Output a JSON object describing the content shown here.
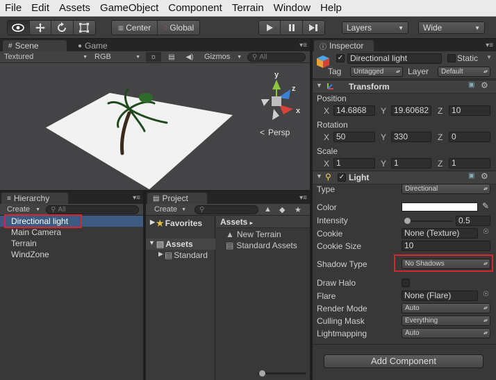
{
  "menubar": [
    "File",
    "Edit",
    "Assets",
    "GameObject",
    "Component",
    "Terrain",
    "Window",
    "Help"
  ],
  "toolbar": {
    "pivot_label": "Center",
    "space_label": "Global",
    "layers_label": "Layers",
    "layout_label": "Wide"
  },
  "scene": {
    "tab_label": "Scene",
    "game_tab_label": "Game",
    "draw_mode": "Textured",
    "render_mode": "RGB",
    "gizmos_label": "Gizmos",
    "search_placeholder": "All",
    "persp_label": "Persp",
    "gizmo_x": "x",
    "gizmo_y": "y",
    "gizmo_z": "z"
  },
  "hierarchy": {
    "tab_label": "Hierarchy",
    "create_label": "Create",
    "search_placeholder": "All",
    "items": [
      "Directional light",
      "Main Camera",
      "Terrain",
      "WindZone"
    ]
  },
  "project": {
    "tab_label": "Project",
    "create_label": "Create",
    "favorites_label": "Favorites",
    "assets_label": "Assets",
    "standard_label": "Standard",
    "assets_header": "Assets",
    "asset_items": [
      "New Terrain",
      "Standard Assets"
    ]
  },
  "inspector": {
    "tab_label": "Inspector",
    "object_name": "Directional light",
    "static_label": "Static",
    "tag_label": "Tag",
    "tag_value": "Untagged",
    "layer_label": "Layer",
    "layer_value": "Default",
    "transform": {
      "title": "Transform",
      "position_label": "Position",
      "position": [
        "14.6868",
        "19.60682",
        "10"
      ],
      "rotation_label": "Rotation",
      "rotation": [
        "50",
        "330",
        "0"
      ],
      "scale_label": "Scale",
      "scale": [
        "1",
        "1",
        "1"
      ],
      "axes": [
        "X",
        "Y",
        "Z"
      ]
    },
    "light": {
      "title": "Light",
      "type_label": "Type",
      "type_value": "Directional",
      "color_label": "Color",
      "intensity_label": "Intensity",
      "intensity_value": "0.5",
      "intensity_fraction": 0.0625,
      "cookie_label": "Cookie",
      "cookie_value": "None (Texture)",
      "cookie_size_label": "Cookie Size",
      "cookie_size_value": "10",
      "shadow_type_label": "Shadow Type",
      "shadow_type_value": "No Shadows",
      "draw_halo_label": "Draw Halo",
      "flare_label": "Flare",
      "flare_value": "None (Flare)",
      "render_mode_label": "Render Mode",
      "render_mode_value": "Auto",
      "culling_mask_label": "Culling Mask",
      "culling_mask_value": "Everything",
      "lightmapping_label": "Lightmapping",
      "lightmapping_value": "Auto"
    },
    "add_component_label": "Add Component"
  },
  "colors": {
    "highlight_box": "#d9262e",
    "selection": "#3d5a80",
    "panel_bg": "#383838"
  }
}
